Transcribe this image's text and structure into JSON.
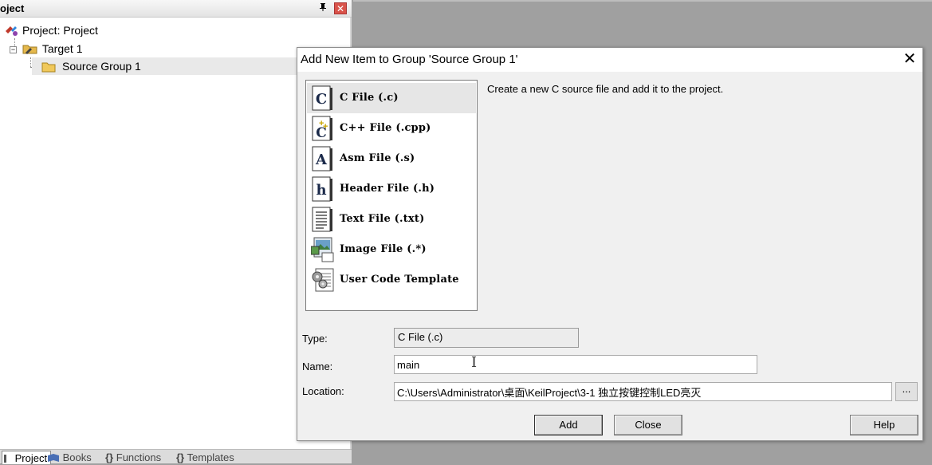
{
  "project_pane": {
    "title": "oject",
    "pin_glyph": "p",
    "close_glyph": "✕",
    "tree": {
      "project": "Project: Project",
      "target": "Target 1",
      "group": "Source Group 1"
    },
    "tabs": [
      {
        "label": "Project"
      },
      {
        "label": "Books"
      },
      {
        "label": "Functions"
      },
      {
        "label": "Templates"
      }
    ]
  },
  "dialog": {
    "title": "Add New Item to Group 'Source Group 1'",
    "close_glyph": "✕",
    "items": [
      {
        "label": "C File (.c)",
        "icon": "c-file-icon"
      },
      {
        "label": "C++ File (.cpp)",
        "icon": "cpp-file-icon"
      },
      {
        "label": "Asm File (.s)",
        "icon": "asm-file-icon"
      },
      {
        "label": "Header File (.h)",
        "icon": "header-file-icon"
      },
      {
        "label": "Text File (.txt)",
        "icon": "text-file-icon"
      },
      {
        "label": "Image File (.*)",
        "icon": "image-file-icon"
      },
      {
        "label": "User Code Template",
        "icon": "code-template-icon"
      }
    ],
    "selected_index": 0,
    "description": "Create a new C source file and add it to the project.",
    "type_label": "Type:",
    "type_value": "C File (.c)",
    "name_label": "Name:",
    "name_value": "main",
    "location_label": "Location:",
    "location_value": "C:\\Users\\Administrator\\桌面\\KeilProject\\3-1 独立按键控制LED亮灭",
    "browse_label": "...",
    "buttons": {
      "add": "Add",
      "close": "Close",
      "help": "Help"
    }
  }
}
